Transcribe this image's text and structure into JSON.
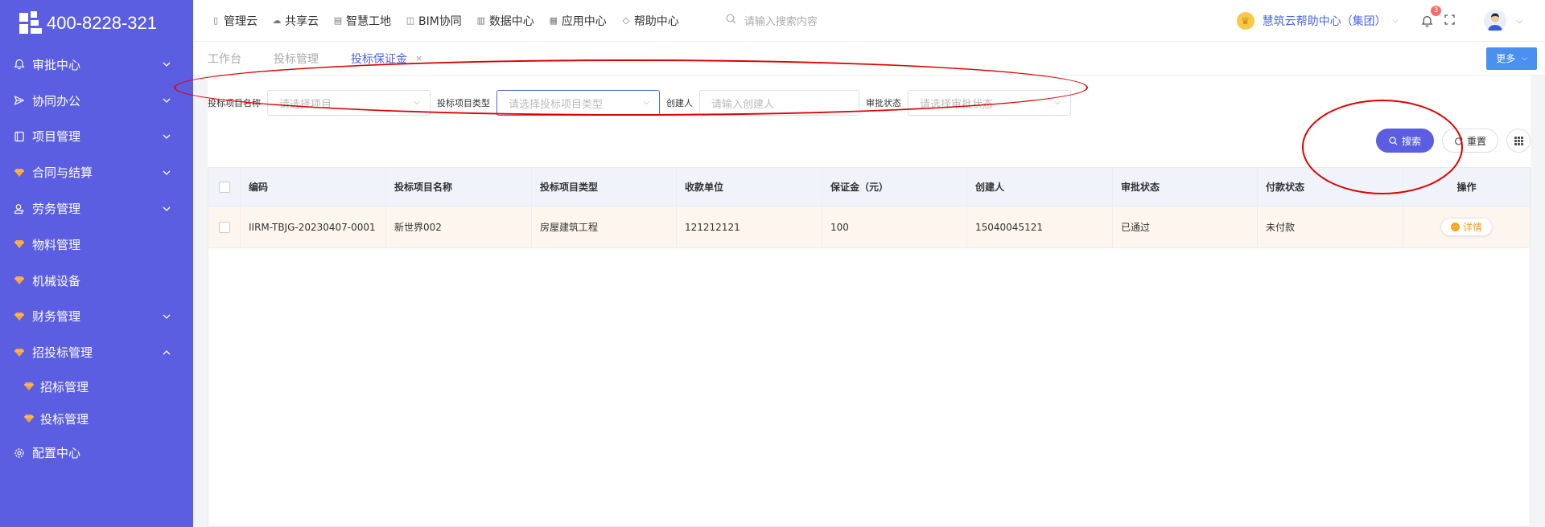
{
  "brand": {
    "phone": "400-8228-321"
  },
  "sidebar": {
    "items": [
      {
        "label": "审批中心",
        "icon": "bell-icon",
        "expandable": true
      },
      {
        "label": "协同办公",
        "icon": "send-icon",
        "expandable": true
      },
      {
        "label": "项目管理",
        "icon": "book-icon",
        "expandable": true
      },
      {
        "label": "合同与结算",
        "icon": "gem-icon",
        "expandable": true
      },
      {
        "label": "劳务管理",
        "icon": "worker-icon",
        "expandable": true
      },
      {
        "label": "物料管理",
        "icon": "gem-icon",
        "expandable": false
      },
      {
        "label": "机械设备",
        "icon": "gem-icon",
        "expandable": false
      },
      {
        "label": "财务管理",
        "icon": "gem-icon",
        "expandable": true
      },
      {
        "label": "招投标管理",
        "icon": "gem-icon",
        "expandable": true,
        "expanded": true
      },
      {
        "label": "配置中心",
        "icon": "gear-icon",
        "expandable": false
      }
    ],
    "sub_items": [
      {
        "label": "招标管理",
        "icon": "gem-icon"
      },
      {
        "label": "投标管理",
        "icon": "gem-icon"
      }
    ]
  },
  "topbar": {
    "nav": [
      {
        "label": "管理云",
        "icon": "tablet-icon"
      },
      {
        "label": "共享云",
        "icon": "cloud-icon"
      },
      {
        "label": "智慧工地",
        "icon": "book-icon"
      },
      {
        "label": "BIM协同",
        "icon": "cube-icon"
      },
      {
        "label": "数据中心",
        "icon": "bar-chart-icon"
      },
      {
        "label": "应用中心",
        "icon": "grid-icon"
      },
      {
        "label": "帮助中心",
        "icon": "tag-icon"
      }
    ],
    "search_placeholder": "请输入搜索内容",
    "org_name": "慧筑云帮助中心（集团）",
    "notification_count": "3"
  },
  "tabs": {
    "items": [
      {
        "label": "工作台",
        "active": false
      },
      {
        "label": "投标管理",
        "active": false
      },
      {
        "label": "投标保证金",
        "active": true,
        "closable": true
      }
    ],
    "close_glyph": "×",
    "more_label": "更多"
  },
  "filters": {
    "project_name": {
      "label": "投标项目名称",
      "placeholder": "请选择项目"
    },
    "project_type": {
      "label": "投标项目类型",
      "placeholder": "请选择投标项目类型"
    },
    "creator": {
      "label": "创建人",
      "placeholder": "请输入创建人"
    },
    "approval_status": {
      "label": "审批状态",
      "placeholder": "请选择审批状态"
    }
  },
  "actions": {
    "search_label": "搜索",
    "reset_label": "重置"
  },
  "table": {
    "columns": [
      "编码",
      "投标项目名称",
      "投标项目类型",
      "收款单位",
      "保证金（元）",
      "创建人",
      "审批状态",
      "付款状态",
      "操作"
    ],
    "rows": [
      {
        "code": "IIRM-TBJG-20230407-0001",
        "project_name": "新世界002",
        "project_type": "房屋建筑工程",
        "payee": "121212121",
        "deposit": "100",
        "creator": "15040045121",
        "approval_status": "已通过",
        "payment_status": "未付款",
        "action_label": "详情"
      }
    ]
  },
  "colors": {
    "sidebar_bg": "#5b5ee0",
    "accent": "#4a64e8",
    "annotation_red": "#e00000",
    "row_highlight": "#fdf6ee"
  }
}
